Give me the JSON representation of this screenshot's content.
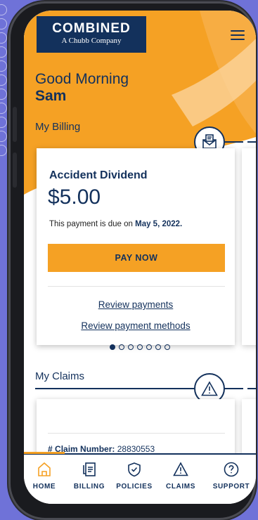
{
  "brand": {
    "logo_main": "COMBINED",
    "logo_sub": "A Chubb Company"
  },
  "colors": {
    "navy": "#13315c",
    "orange": "#f5a124",
    "background": "#6f72d8"
  },
  "greeting": {
    "line": "Good Morning",
    "name": "Sam"
  },
  "billing": {
    "section_title": "My Billing",
    "icon": "envelope-dollar-icon",
    "card": {
      "title": "Accident Dividend",
      "amount": "$5.00",
      "due_prefix": "This payment is due on",
      "due_date": "May 5, 2022.",
      "pay_button": "PAY NOW",
      "review_payments": "Review payments",
      "review_methods": "Review payment methods"
    },
    "pagination": {
      "total": 7,
      "active": 0
    }
  },
  "claims": {
    "section_title": "My Claims",
    "icon": "warning-triangle-icon",
    "claim_number_label": "Claim Number:",
    "claim_number": "28830553"
  },
  "tabs": [
    {
      "label": "HOME",
      "icon": "home-icon"
    },
    {
      "label": "BILLING",
      "icon": "billing-icon"
    },
    {
      "label": "POLICIES",
      "icon": "shield-icon"
    },
    {
      "label": "CLAIMS",
      "icon": "warning-icon"
    },
    {
      "label": "SUPPORT",
      "icon": "help-icon"
    }
  ]
}
